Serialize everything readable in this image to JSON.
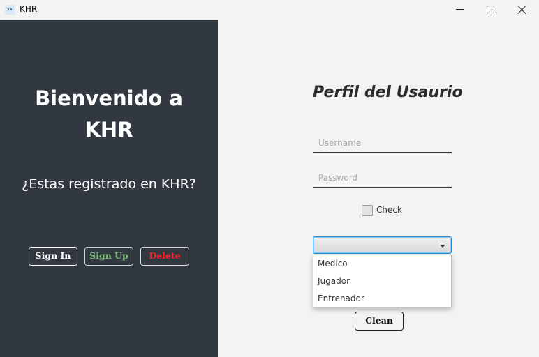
{
  "window": {
    "title": "KHR",
    "icon": "app-icon",
    "controls": [
      "minimize-icon",
      "maximize-icon",
      "close-icon"
    ]
  },
  "left_panel": {
    "background": "#323840",
    "welcome_line1": "Bienvenido a",
    "welcome_line2": "KHR",
    "question": "¿Estas registrado en KHR?",
    "buttons": {
      "signin": "Sign In",
      "signup": "Sign Up",
      "delete": "Delete"
    },
    "colors": {
      "signin": "#ffffff",
      "signup": "#7ac07a",
      "delete": "#ff1f1f"
    }
  },
  "right_panel": {
    "title": "Perfil del Usaurio",
    "username_placeholder": "Username",
    "password_placeholder": "Password",
    "check_label": "Check",
    "combo_selected": "",
    "combo_options": [
      "Medico",
      "Jugador",
      "Entrenador"
    ],
    "clean_label": "Clean"
  }
}
